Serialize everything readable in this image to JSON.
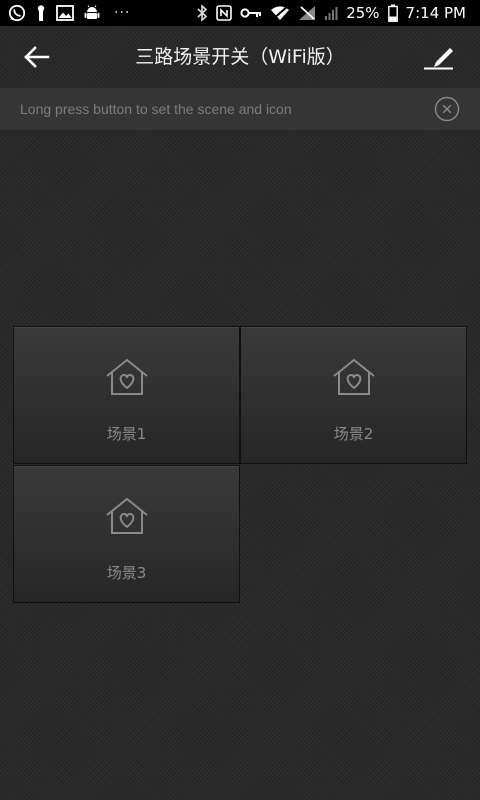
{
  "status_bar": {
    "battery_percent": "25%",
    "time": "7:14 PM",
    "left_icons": [
      "whatsapp-icon",
      "key-icon",
      "image-icon",
      "android-icon",
      "more-dots-icon"
    ],
    "right_icons": [
      "bluetooth-icon",
      "nfc-icon",
      "vpn-key-icon",
      "wifi-icon",
      "no-signal-icon",
      "signal-icon",
      "battery-icon"
    ],
    "overflow_dots": "···"
  },
  "toolbar": {
    "title": "三路场景开关（WiFi版）",
    "back_icon": "arrow-left-icon",
    "edit_icon": "edit-pen-icon"
  },
  "hint": {
    "text": "Long press button to set the scene and icon",
    "close_icon": "close-circle-icon"
  },
  "scenes": [
    {
      "label": "场景1",
      "icon": "house-heart-icon"
    },
    {
      "label": "场景2",
      "icon": "house-heart-icon"
    },
    {
      "label": "场景3",
      "icon": "house-heart-icon"
    }
  ],
  "colors": {
    "background": "#2a2a2a",
    "hint_bar": "#353535",
    "hint_text": "#7d7d7d",
    "tile_icon": "#8a8a8a",
    "title_text": "#f2f2f2"
  }
}
